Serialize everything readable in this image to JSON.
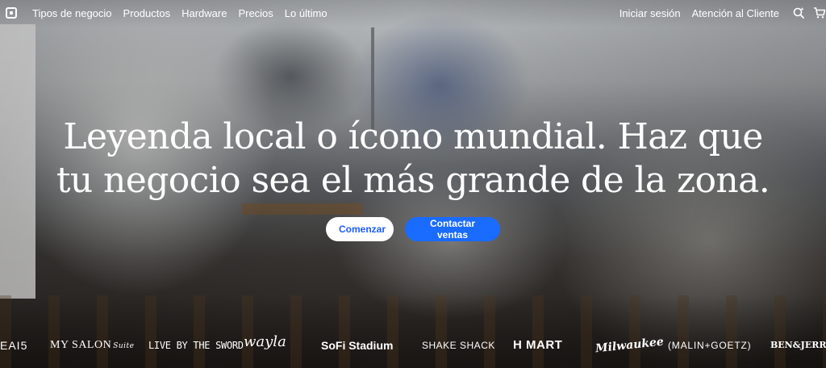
{
  "nav": {
    "left_links": [
      "Tipos de negocio",
      "Productos",
      "Hardware",
      "Precios",
      "Lo último"
    ],
    "right_links": [
      "Iniciar sesión",
      "Atención al Cliente"
    ],
    "icons": [
      "logo-square-icon",
      "search-sparkle-icon",
      "cart-icon"
    ]
  },
  "hero": {
    "headline_line1": "Leyenda local o ícono mundial. Haz que",
    "headline_line2": "tu negocio sea el más grande de la zona.",
    "cta_primary": "Comenzar",
    "cta_secondary": "Contactar ventas"
  },
  "logos": [
    "EAI5",
    "MY SALON",
    "Suite",
    "LIVE BY THE SWORD",
    "wayla",
    "SoFi Stadium",
    "SHAKE SHACK",
    "H MART",
    "Milwaukee",
    "(MALIN+GOETZ)",
    "BEN&JERRY"
  ],
  "colors": {
    "accent_blue": "#1a6bff",
    "primary_text_blue": "#1a5cff",
    "white": "#ffffff"
  }
}
